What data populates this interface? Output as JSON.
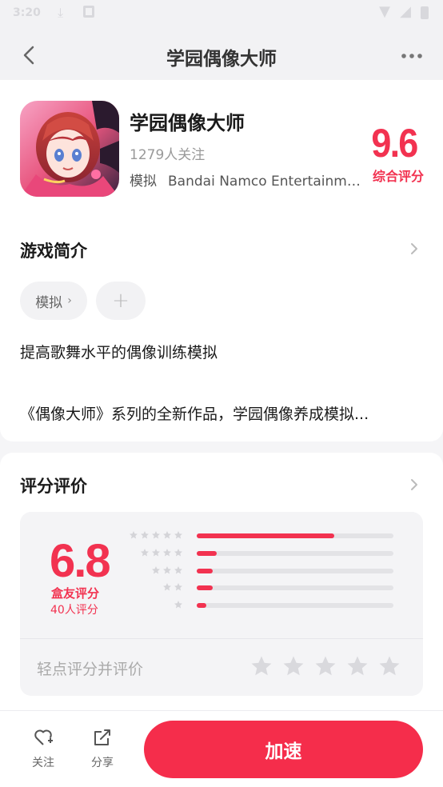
{
  "status_bar": {
    "time": "3:20"
  },
  "nav": {
    "title": "学园偶像大师"
  },
  "app": {
    "name": "学园偶像大师",
    "followers": "1279人关注",
    "genre": "模拟",
    "developer": "Bandai Namco Entertainme...",
    "overall_score": "9.6",
    "overall_label": "综合评分"
  },
  "intro": {
    "title": "游戏简介",
    "tag": "模拟",
    "add_tag": "+",
    "line1": "提高歌舞水平的偶像训练模拟",
    "line2": "《偶像大师》系列的全新作品，学园偶像养成模拟..."
  },
  "rating": {
    "title": "评分评价",
    "score": "6.8",
    "score_label": "盒友评分",
    "count": "40人评分",
    "distribution": [
      {
        "stars": 5,
        "fraction": 0.7
      },
      {
        "stars": 4,
        "fraction": 0.1
      },
      {
        "stars": 3,
        "fraction": 0.08
      },
      {
        "stars": 2,
        "fraction": 0.08
      },
      {
        "stars": 1,
        "fraction": 0.05
      }
    ],
    "tap_prompt": "轻点评分并评价"
  },
  "bottom": {
    "follow_label": "关注",
    "share_label": "分享",
    "accelerate_label": "加速"
  },
  "colors": {
    "accent": "#f23250",
    "button": "#f52d4b"
  }
}
